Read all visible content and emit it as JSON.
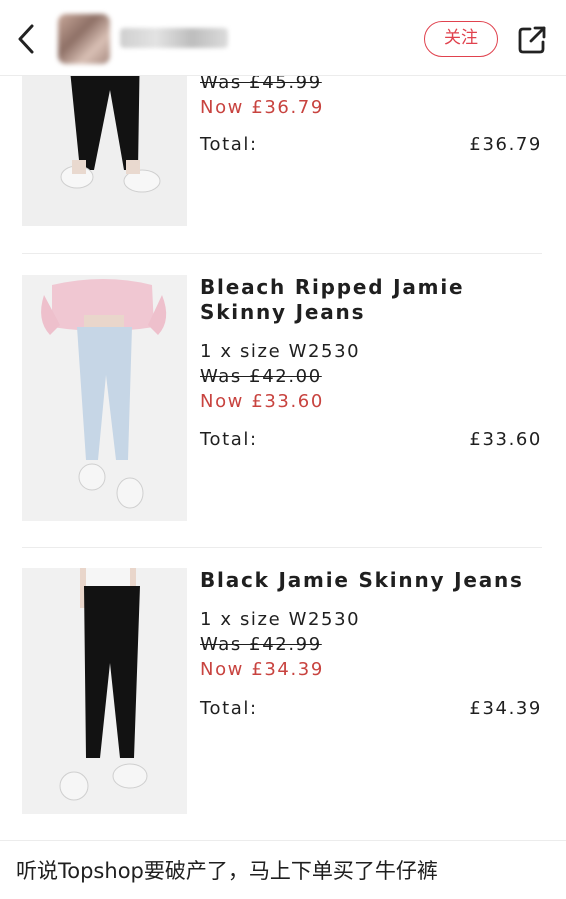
{
  "header": {
    "follow_label": "关注",
    "icons": {
      "back": "chevron-left-icon",
      "share": "share-external-icon"
    }
  },
  "products": [
    {
      "name": "",
      "qty": "",
      "was": "Was £45.99",
      "now": "Now £36.79",
      "total_label": "Total:",
      "total_value": "£36.79",
      "jeans_color": "#121212"
    },
    {
      "name": "Bleach Ripped Jamie Skinny Jeans",
      "qty": "1 x size W2530",
      "was": "Was £42.00",
      "now": "Now £33.60",
      "total_label": "Total:",
      "total_value": "£33.60",
      "jeans_color": "#c6d6e6"
    },
    {
      "name": "Black Jamie Skinny Jeans",
      "qty": "1 x size W2530",
      "was": "Was £42.99",
      "now": "Now £34.39",
      "total_label": "Total:",
      "total_value": "£34.39",
      "jeans_color": "#121212"
    }
  ],
  "caption": "听说Topshop要破产了，马上下单买了牛仔裤",
  "colors": {
    "accent": "#e0424e",
    "sale": "#c8433f"
  }
}
